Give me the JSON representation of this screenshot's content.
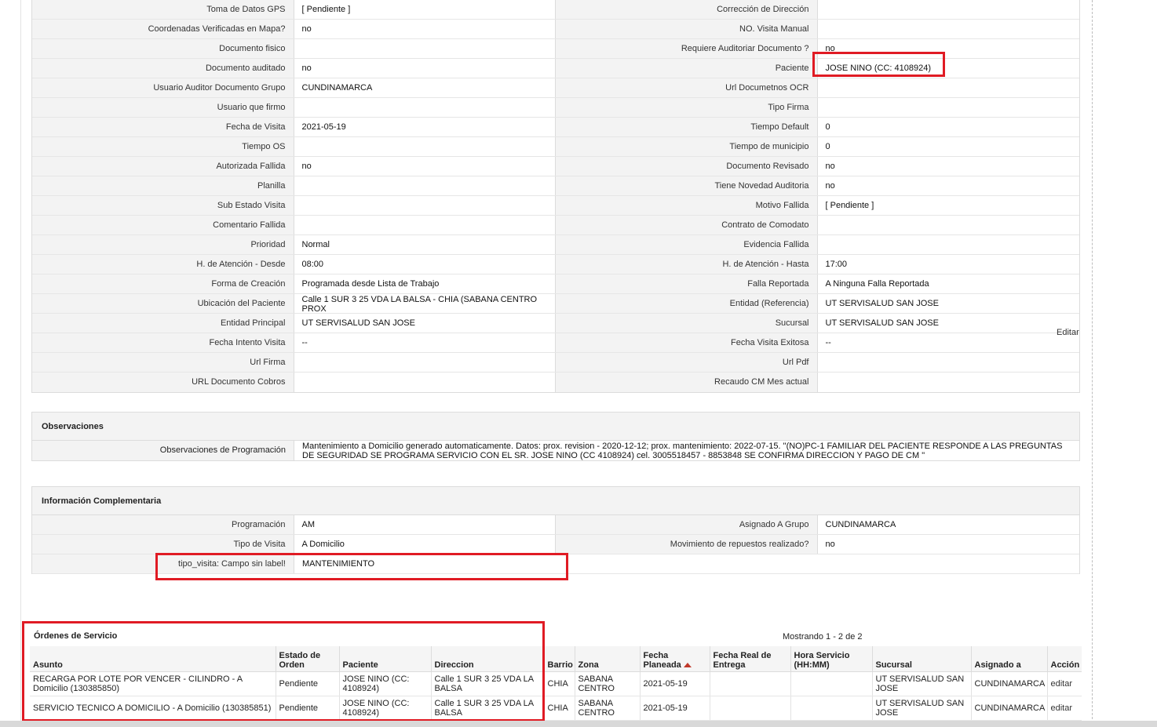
{
  "details_rows": [
    [
      {
        "label": "Toma de Datos GPS",
        "value": "[ Pendiente ]"
      },
      {
        "label": "Corrección de Dirección",
        "value": ""
      }
    ],
    [
      {
        "label": "Coordenadas Verificadas en Mapa?",
        "value": "no"
      },
      {
        "label": "NO. Visita Manual",
        "value": ""
      }
    ],
    [
      {
        "label": "Documento fisico",
        "value": ""
      },
      {
        "label": "Requiere Auditoriar Documento ?",
        "value": "no"
      }
    ],
    [
      {
        "label": "Documento auditado",
        "value": "no"
      },
      {
        "label": "Paciente",
        "value": "JOSE NINO (CC: 4108924)"
      }
    ],
    [
      {
        "label": "Usuario Auditor Documento Grupo",
        "value": "CUNDINAMARCA"
      },
      {
        "label": "Url Documetnos OCR",
        "value": ""
      }
    ],
    [
      {
        "label": "Usuario que firmo",
        "value": ""
      },
      {
        "label": "Tipo Firma",
        "value": ""
      }
    ],
    [
      {
        "label": "Fecha de Visita",
        "value": "2021-05-19"
      },
      {
        "label": "Tiempo Default",
        "value": "0"
      }
    ],
    [
      {
        "label": "Tiempo OS",
        "value": ""
      },
      {
        "label": "Tiempo de municipio",
        "value": "0"
      }
    ],
    [
      {
        "label": "Autorizada Fallida",
        "value": "no"
      },
      {
        "label": "Documento Revisado",
        "value": "no"
      }
    ],
    [
      {
        "label": "Planilla",
        "value": ""
      },
      {
        "label": "Tiene Novedad Auditoria",
        "value": "no"
      }
    ],
    [
      {
        "label": "Sub Estado Visita",
        "value": ""
      },
      {
        "label": "Motivo Fallida",
        "value": "[ Pendiente ]"
      }
    ],
    [
      {
        "label": "Comentario Fallida",
        "value": ""
      },
      {
        "label": "Contrato de Comodato",
        "value": ""
      }
    ],
    [
      {
        "label": "Prioridad",
        "value": "Normal"
      },
      {
        "label": "Evidencia Fallida",
        "value": ""
      }
    ],
    [
      {
        "label": "H. de Atención - Desde",
        "value": "08:00"
      },
      {
        "label": "H. de Atención - Hasta",
        "value": "17:00"
      }
    ],
    [
      {
        "label": "Forma de Creación",
        "value": "Programada desde Lista de Trabajo"
      },
      {
        "label": "Falla Reportada",
        "value": "A Ninguna Falla Reportada"
      }
    ],
    [
      {
        "label": "Ubicación del Paciente",
        "value": "Calle 1 SUR 3 25 VDA LA BALSA - CHIA (SABANA CENTRO PROX"
      },
      {
        "label": "Entidad (Referencia)",
        "value": "UT SERVISALUD SAN JOSE"
      }
    ],
    [
      {
        "label": "Entidad Principal",
        "value": "UT SERVISALUD SAN JOSE"
      },
      {
        "label": "Sucursal",
        "value": "UT SERVISALUD SAN JOSE"
      }
    ],
    [
      {
        "label": "Fecha Intento Visita",
        "value": "--"
      },
      {
        "label": "Fecha Visita Exitosa",
        "value": "--"
      }
    ],
    [
      {
        "label": "Url Firma",
        "value": ""
      },
      {
        "label": "Url Pdf",
        "value": ""
      }
    ],
    [
      {
        "label": "URL Documento Cobros",
        "value": ""
      },
      {
        "label": "Recaudo CM Mes actual",
        "value": ""
      }
    ]
  ],
  "editar_label": "Editar",
  "observaciones": {
    "title": "Observaciones",
    "label": "Observaciones de Programación",
    "value": "Mantenimiento a Domicilio generado automaticamente. Datos: prox. revision - 2020-12-12; prox. mantenimiento: 2022-07-15. \"(NO)PC-1 FAMILIAR DEL PACIENTE RESPONDE A LAS PREGUNTAS DE SEGURIDAD SE PROGRAMA SERVICIO CON EL SR. JOSE NINO (CC 4108924) cel. 3005518457 - 8853848 SE CONFIRMA DIRECCION Y PAGO DE CM \""
  },
  "complementaria": {
    "title": "Información Complementaria",
    "rows": [
      [
        {
          "label": "Programación",
          "value": "AM"
        },
        {
          "label": "Asignado A Grupo",
          "value": "CUNDINAMARCA"
        }
      ],
      [
        {
          "label": "Tipo de Visita",
          "value": "A Domicilio"
        },
        {
          "label": "Movimiento de repuestos realizado?",
          "value": "no"
        }
      ],
      [
        {
          "label": "tipo_visita: Campo sin label!",
          "value": "MANTENIMIENTO"
        }
      ]
    ]
  },
  "ordenes": {
    "title": "Órdenes de Servicio",
    "count": "Mostrando 1 - 2 de 2",
    "columns": [
      "Asunto",
      "Estado de Orden",
      "Paciente",
      "Direccion",
      "Barrio",
      "Zona",
      "Fecha Planeada",
      "Fecha Real de Entrega",
      "Hora Servicio (HH:MM)",
      "Sucursal",
      "Asignado a",
      "Acción"
    ],
    "rows": [
      [
        "RECARGA POR LOTE POR VENCER - CILINDRO - A Domicilio (130385850)",
        "Pendiente",
        "JOSE NINO (CC: 4108924)",
        "Calle 1 SUR 3 25 VDA LA BALSA",
        "CHIA",
        "SABANA CENTRO",
        "2021-05-19",
        "",
        "",
        "UT SERVISALUD SAN JOSE",
        "CUNDINAMARCA",
        "editar"
      ],
      [
        "SERVICIO TECNICO A DOMICILIO - A Domicilio (130385851)",
        "Pendiente",
        "JOSE NINO (CC: 4108924)",
        "Calle 1 SUR 3 25 VDA LA BALSA",
        "CHIA",
        "SABANA CENTRO",
        "2021-05-19",
        "",
        "",
        "UT SERVISALUD SAN JOSE",
        "CUNDINAMARCA",
        "editar"
      ]
    ]
  },
  "colors": {
    "highlight": "#e01b24",
    "label_bg": "#f3f3f3",
    "border": "#dcdcdc"
  }
}
